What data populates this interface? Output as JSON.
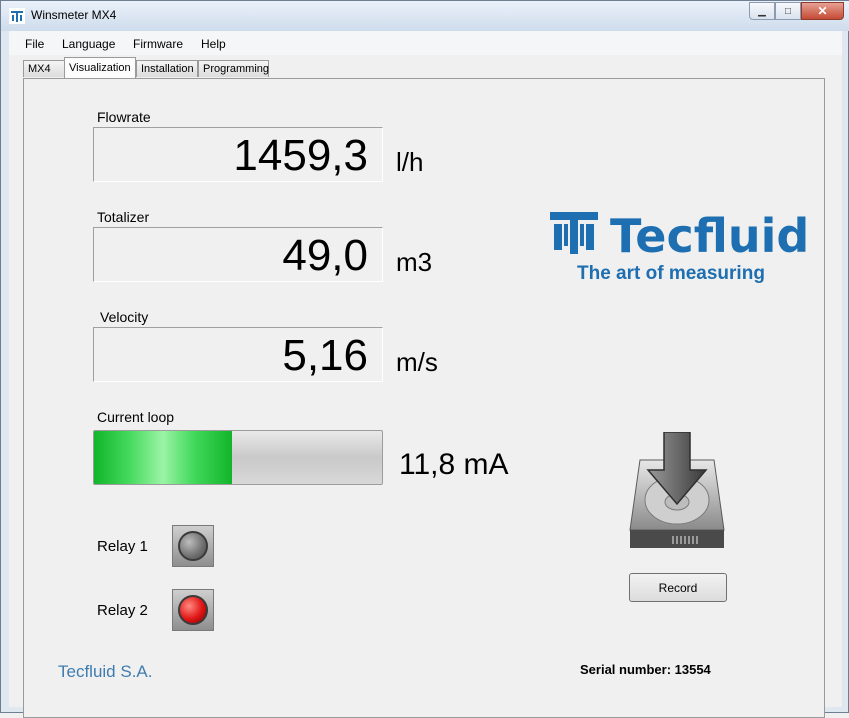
{
  "window": {
    "title": "Winsmeter MX4"
  },
  "menu": [
    {
      "label": "File"
    },
    {
      "label": "Language"
    },
    {
      "label": "Firmware"
    },
    {
      "label": "Help"
    }
  ],
  "tabs": [
    {
      "label": "MX4",
      "active": false
    },
    {
      "label": "Visualization",
      "active": true
    },
    {
      "label": "Installation",
      "active": false
    },
    {
      "label": "Programming",
      "active": false
    }
  ],
  "measures": {
    "flowrate": {
      "label": "Flowrate",
      "value": "1459,3",
      "unit": "l/h"
    },
    "totalizer": {
      "label": "Totalizer",
      "value": "49,0",
      "unit": "m3"
    },
    "velocity": {
      "label": "Velocity",
      "value": "5,16",
      "unit": "m/s"
    }
  },
  "current_loop": {
    "label": "Current loop",
    "value": "11,8 mA",
    "fill_fraction": 0.48,
    "fill_color": "#1fc43a"
  },
  "relays": [
    {
      "label": "Relay 1",
      "state": "off",
      "color": "#808080"
    },
    {
      "label": "Relay 2",
      "state": "on",
      "color": "#e01515"
    }
  ],
  "logo": {
    "wordmark": "Tecfluid",
    "tagline": "The art of measuring",
    "color": "#1d6fb1"
  },
  "record": {
    "button_label": "Record",
    "icon": "hard-drive-download-icon"
  },
  "footer": {
    "company": "Tecfluid S.A.",
    "serial": "Serial number: 13554"
  }
}
